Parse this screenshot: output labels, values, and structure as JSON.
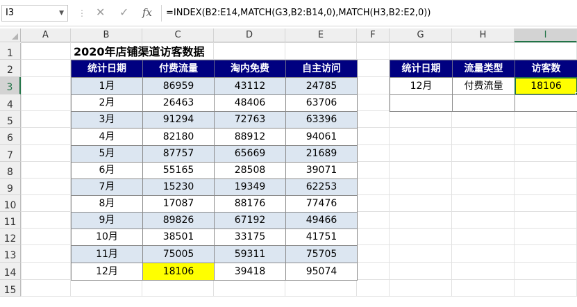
{
  "formula_bar": {
    "name_box": "I3",
    "cancel_icon": "✕",
    "enter_icon": "✓",
    "fx_label": "fx",
    "formula": "=INDEX(B2:E14,MATCH(G3,B2:B14,0),MATCH(H3,B2:E2,0))"
  },
  "columns": [
    "A",
    "B",
    "C",
    "D",
    "E",
    "F",
    "G",
    "H",
    "I"
  ],
  "rows": [
    "1",
    "2",
    "3",
    "4",
    "5",
    "6",
    "7",
    "8",
    "9",
    "10",
    "11",
    "12",
    "13",
    "14",
    "15"
  ],
  "title": "2020年店铺渠道访客数据",
  "main_table": {
    "headers": [
      "统计日期",
      "付费流量",
      "淘内免费",
      "自主访问"
    ],
    "rows": [
      [
        "1月",
        "86959",
        "43112",
        "24785"
      ],
      [
        "2月",
        "26463",
        "48406",
        "63706"
      ],
      [
        "3月",
        "91294",
        "72763",
        "63396"
      ],
      [
        "4月",
        "82180",
        "88912",
        "94061"
      ],
      [
        "5月",
        "87757",
        "65669",
        "21689"
      ],
      [
        "6月",
        "55165",
        "28508",
        "39071"
      ],
      [
        "7月",
        "15230",
        "19349",
        "62253"
      ],
      [
        "8月",
        "17087",
        "88176",
        "77476"
      ],
      [
        "9月",
        "89826",
        "67192",
        "49466"
      ],
      [
        "10月",
        "38501",
        "33175",
        "41751"
      ],
      [
        "11月",
        "75005",
        "59311",
        "75705"
      ],
      [
        "12月",
        "18106",
        "39418",
        "95074"
      ]
    ]
  },
  "lookup_table": {
    "headers": [
      "统计日期",
      "流量类型",
      "访客数"
    ],
    "row": [
      "12月",
      "付费流量",
      "18106"
    ]
  },
  "colors": {
    "header_bg": "#000080",
    "band_blue": "#dce6f1",
    "highlight": "#ffff00",
    "selection": "#217346"
  }
}
